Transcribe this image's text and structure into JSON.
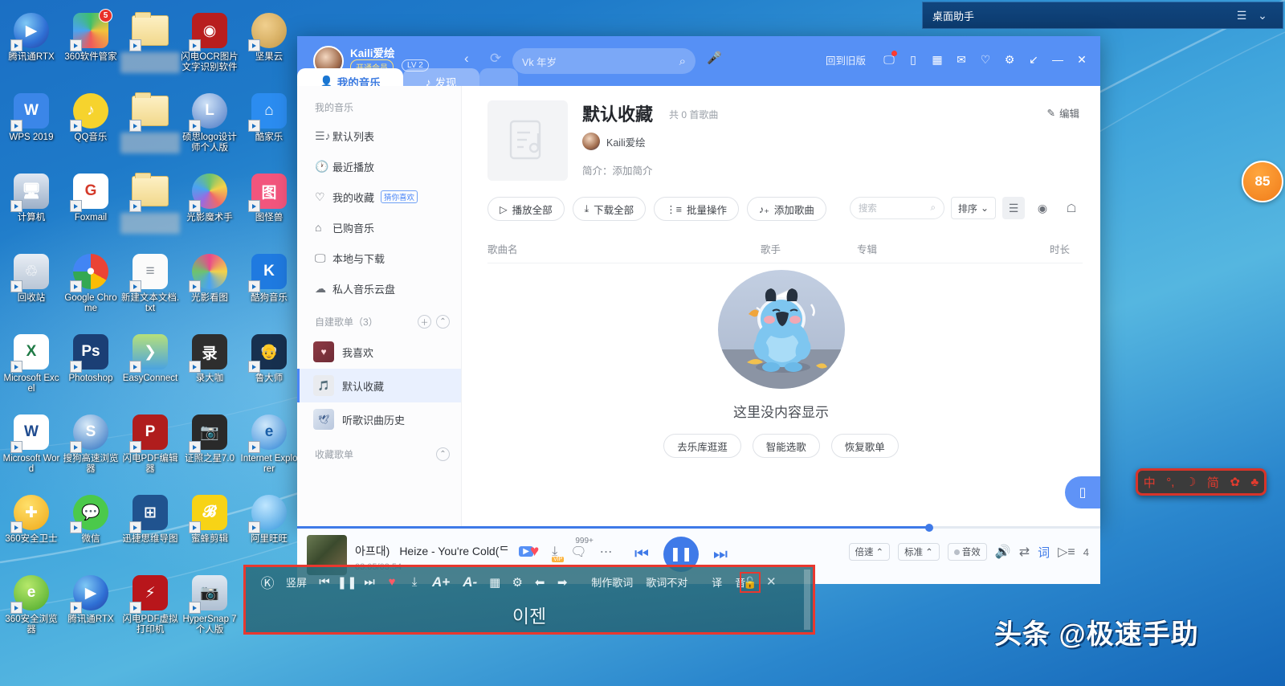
{
  "desktop": {
    "icons": [
      {
        "label": "腾讯通RTX",
        "icon": "rtx-icon",
        "blur": false
      },
      {
        "label": "360软件管家",
        "icon": "360-software-manager-icon",
        "blur": false,
        "badge": "5"
      },
      {
        "label": "",
        "icon": "folder-icon",
        "blur": true
      },
      {
        "label": "闪电OCR图片文字识别软件",
        "icon": "ocr-icon",
        "blur": false
      },
      {
        "label": "坚果云",
        "icon": "nutstore-icon",
        "blur": false
      },
      {
        "label": "WPS 2019",
        "icon": "wps-icon",
        "blur": false
      },
      {
        "label": "QQ音乐",
        "icon": "qq-music-icon",
        "blur": false
      },
      {
        "label": "",
        "icon": "folder-icon",
        "blur": true
      },
      {
        "label": "硕思logo设计师个人版",
        "icon": "sothink-logo-icon",
        "blur": false
      },
      {
        "label": "酷家乐",
        "icon": "kujiale-icon",
        "blur": false
      },
      {
        "label": "计算机",
        "icon": "computer-icon",
        "blur": false
      },
      {
        "label": "Foxmail",
        "icon": "foxmail-icon",
        "blur": false
      },
      {
        "label": "",
        "icon": "folder-icon",
        "blur": true
      },
      {
        "label": "光影魔术手",
        "icon": "neoimaging-icon",
        "blur": false
      },
      {
        "label": "图怪兽",
        "icon": "818ps-icon",
        "blur": false
      },
      {
        "label": "回收站",
        "icon": "recycle-bin-icon",
        "blur": false
      },
      {
        "label": "Google Chrome",
        "icon": "chrome-icon",
        "blur": false
      },
      {
        "label": "新建文本文档.txt",
        "icon": "text-file-icon",
        "blur": false
      },
      {
        "label": "光影看图",
        "icon": "photo-viewer-icon",
        "blur": false
      },
      {
        "label": "酷狗音乐",
        "icon": "kugou-icon",
        "blur": false
      },
      {
        "label": "Microsoft Excel",
        "icon": "excel-icon",
        "blur": false
      },
      {
        "label": "Photoshop",
        "icon": "photoshop-icon",
        "blur": false
      },
      {
        "label": "EasyConnect",
        "icon": "easyconnect-icon",
        "blur": false
      },
      {
        "label": "录大咖",
        "icon": "luda-recorder-icon",
        "blur": false
      },
      {
        "label": "鲁大师",
        "icon": "ludashi-icon",
        "blur": false
      },
      {
        "label": "Microsoft Word",
        "icon": "word-icon",
        "blur": false
      },
      {
        "label": "搜狗高速浏览器",
        "icon": "sogou-browser-icon",
        "blur": false
      },
      {
        "label": "闪电PDF编辑器",
        "icon": "pdf-editor-icon",
        "blur": false
      },
      {
        "label": "证照之星7.0",
        "icon": "id-photo-icon",
        "blur": false
      },
      {
        "label": "Internet Explorer",
        "icon": "ie-icon",
        "blur": false
      },
      {
        "label": "360安全卫士",
        "icon": "360-safe-icon",
        "blur": false
      },
      {
        "label": "微信",
        "icon": "wechat-icon",
        "blur": false
      },
      {
        "label": "迅捷思维导图",
        "icon": "mindmap-icon",
        "blur": false
      },
      {
        "label": "蜜蜂剪辑",
        "icon": "beecut-icon",
        "blur": false
      },
      {
        "label": "阿里旺旺",
        "icon": "aliwangwang-icon",
        "blur": false
      },
      {
        "label": "360安全浏览器",
        "icon": "360-browser-icon",
        "blur": false
      },
      {
        "label": "腾讯通RTX",
        "icon": "rtx-icon",
        "blur": false
      },
      {
        "label": "闪电PDF虚拟打印机",
        "icon": "pdf-printer-icon",
        "blur": false
      },
      {
        "label": "HyperSnap 7 个人版",
        "icon": "hypersnap-icon",
        "blur": false
      },
      {
        "label": "",
        "icon": "blank-icon",
        "blur": false
      }
    ],
    "watermark": "头条 @极速手助",
    "floating_badge": "85"
  },
  "assistant_window": {
    "title": "桌面助手",
    "menu_icon": "hamburger-icon",
    "collapse_icon": "chevron-down-icon"
  },
  "kugou": {
    "header": {
      "username": "Kaili爱绘",
      "vip_tag": "开通会员",
      "level_tag": "LV 2",
      "back_icon": "chevron-left-icon",
      "refresh_icon": "refresh-icon",
      "mic_icon": "voice-search-icon",
      "search": {
        "value": "Vk 年岁",
        "placeholder": "搜索",
        "icon": "search-icon"
      },
      "old_version": "回到旧版",
      "tools": [
        {
          "name": "desktop-lyric-icon",
          "glyph": "🖵",
          "dot": true
        },
        {
          "name": "mobile-link-icon",
          "glyph": "▯",
          "dot": false
        },
        {
          "name": "apps-grid-icon",
          "glyph": "▦",
          "dot": false
        },
        {
          "name": "mail-icon",
          "glyph": "✉",
          "dot": false
        },
        {
          "name": "skin-icon",
          "glyph": "♡",
          "dot": false
        },
        {
          "name": "settings-gear-icon",
          "glyph": "⚙",
          "dot": false
        },
        {
          "name": "mini-mode-icon",
          "glyph": "↙",
          "dot": false
        },
        {
          "name": "minimize-icon",
          "glyph": "—",
          "dot": false
        },
        {
          "name": "close-icon",
          "glyph": "✕",
          "dot": false
        }
      ]
    },
    "tabs": [
      {
        "label": "我的音乐",
        "icon": "user-icon",
        "active": true
      },
      {
        "label": "发现",
        "icon": "note-icon",
        "active": false
      }
    ],
    "sidebar": {
      "section_title": "我的音乐",
      "items": [
        {
          "label": "默认列表",
          "icon": "list-music-icon",
          "tag": ""
        },
        {
          "label": "最近播放",
          "icon": "clock-icon",
          "tag": ""
        },
        {
          "label": "我的收藏",
          "icon": "heart-icon",
          "tag": "猜你喜欢"
        },
        {
          "label": "已购音乐",
          "icon": "bag-icon",
          "tag": ""
        },
        {
          "label": "本地与下载",
          "icon": "monitor-icon",
          "tag": ""
        },
        {
          "label": "私人音乐云盘",
          "icon": "cloud-icon",
          "tag": ""
        }
      ],
      "custom_section": {
        "title": "自建歌单（3）",
        "add_icon": "plus-icon",
        "collapse_icon": "chevron-up-icon",
        "playlists": [
          {
            "label": "我喜欢",
            "selected": false,
            "cover": "heart-chart-cover"
          },
          {
            "label": "默认收藏",
            "selected": true,
            "cover": "note-doc-cover"
          },
          {
            "label": "听歌识曲历史",
            "selected": false,
            "cover": "bird-cover"
          }
        ]
      },
      "fav_section": {
        "title": "收藏歌单",
        "collapse_icon": "chevron-up-icon"
      }
    },
    "playlist": {
      "cover_icon": "playlist-cover-icon",
      "title": "默认收藏",
      "count": "共 0 首歌曲",
      "owner": "Kaili爱绘",
      "desc": "简介：添加简介",
      "edit": "编辑",
      "edit_icon": "pencil-icon",
      "actions": [
        {
          "label": "播放全部",
          "icon": "play-icon"
        },
        {
          "label": "下载全部",
          "icon": "download-icon"
        },
        {
          "label": "批量操作",
          "icon": "batch-icon"
        },
        {
          "label": "添加歌曲",
          "icon": "add-note-icon"
        }
      ],
      "search": {
        "placeholder": "搜索",
        "icon": "search-icon"
      },
      "sort": {
        "label": "排序",
        "icon": "chevron-down-icon"
      },
      "view_icons": [
        {
          "name": "list-view-icon",
          "glyph": "☰",
          "active": true
        },
        {
          "name": "disc-view-icon",
          "glyph": "◉",
          "active": false
        },
        {
          "name": "singer-view-icon",
          "glyph": "☖",
          "active": false
        }
      ],
      "columns": [
        "歌曲名",
        "歌手",
        "专辑",
        "时长"
      ],
      "empty": {
        "text": "这里没内容显示",
        "mascot": "kugou-dog-mascot",
        "buttons": [
          "去乐库逛逛",
          "智能选歌",
          "恢复歌单"
        ]
      },
      "side_phone_icon": "phone-panel-icon"
    },
    "player": {
      "progress_percent": 78.7,
      "song_prefix": "아프대)",
      "song_title": "Heize - You're Cold(ᄃ",
      "mv_icon": "mv-play-icon",
      "time": "03:05/03:54",
      "left_icons": [
        {
          "name": "favorite-heart-icon",
          "glyph": "♥"
        },
        {
          "name": "download-vip-icon",
          "glyph": "⤓",
          "badge": "VIP"
        },
        {
          "name": "comment-icon",
          "glyph": "💬",
          "count": "999+"
        },
        {
          "name": "more-icon",
          "glyph": "⋯"
        }
      ],
      "prev_icon": "prev-track-icon",
      "play_icon": "pause-icon",
      "next_icon": "next-track-icon",
      "chips": [
        {
          "label": "倍速",
          "icon": "chevron-up-icon",
          "dot": false
        },
        {
          "label": "标准",
          "icon": "chevron-up-icon",
          "dot": false
        },
        {
          "label": "音效",
          "icon": "",
          "dot": true
        }
      ],
      "right_icons": [
        {
          "name": "volume-icon",
          "glyph": "🔊"
        },
        {
          "name": "play-mode-shuffle-icon",
          "glyph": "⇄"
        },
        {
          "name": "lyrics-icon",
          "glyph": "词"
        }
      ],
      "queue": {
        "icon": "queue-list-icon",
        "count": "4"
      }
    },
    "desktop_lyric": {
      "logo_icon": "kugou-k-icon",
      "buttons": [
        {
          "label": "竖屏",
          "name": "vertical-mode-button",
          "type": "text"
        },
        {
          "label": "",
          "name": "prev-track-icon",
          "type": "icon",
          "glyph": "⏮"
        },
        {
          "label": "",
          "name": "pause-icon",
          "type": "icon",
          "glyph": "⏸"
        },
        {
          "label": "",
          "name": "next-track-icon",
          "type": "icon",
          "glyph": "⏭"
        },
        {
          "label": "",
          "name": "favorite-heart-icon",
          "type": "icon",
          "glyph": "♥"
        },
        {
          "label": "",
          "name": "download-icon",
          "type": "icon",
          "glyph": "⤓"
        },
        {
          "label": "A+",
          "name": "font-increase-button",
          "type": "text"
        },
        {
          "label": "A-",
          "name": "font-decrease-button",
          "type": "text"
        },
        {
          "label": "",
          "name": "color-palette-icon",
          "type": "icon",
          "glyph": "▦"
        },
        {
          "label": "",
          "name": "settings-gear-icon",
          "type": "icon",
          "glyph": "⚙"
        },
        {
          "label": "",
          "name": "lyric-delay-back-icon",
          "type": "icon",
          "glyph": "⬅"
        },
        {
          "label": "",
          "name": "lyric-delay-forward-icon",
          "type": "icon",
          "glyph": "➡"
        },
        {
          "label": "制作歌词",
          "name": "make-lyric-button",
          "type": "text"
        },
        {
          "label": "歌词不对",
          "name": "wrong-lyric-button",
          "type": "text"
        },
        {
          "label": "译",
          "name": "translate-button",
          "type": "text"
        },
        {
          "label": "音",
          "name": "phonetic-button",
          "type": "text"
        }
      ],
      "lock_icon": "lock-icon",
      "close_icon": "close-icon",
      "lyric_text": "이젠"
    }
  },
  "ime": {
    "items": [
      {
        "name": "chinese-mode-icon",
        "glyph": "中"
      },
      {
        "name": "punctuation-icon",
        "glyph": "°,"
      },
      {
        "name": "moon-icon",
        "glyph": "☽"
      },
      {
        "name": "simplified-icon",
        "glyph": "简"
      },
      {
        "name": "settings-gear-icon",
        "glyph": "⚙"
      },
      {
        "name": "skin-icon",
        "glyph": "👕"
      }
    ]
  }
}
